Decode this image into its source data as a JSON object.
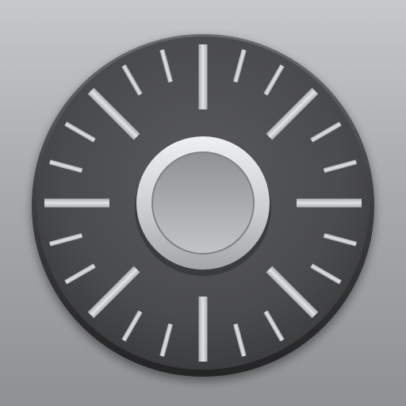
{
  "icon": {
    "name": "combination-dial-icon",
    "colors": {
      "background_top": "#c6c8ca",
      "background_bottom": "#8e9193",
      "dial_face": "#4d4e50",
      "dial_rim": "#2e2f31",
      "tick_marks": "#c4c6c9",
      "knob_outer": "#dcdee0",
      "knob_inner": "#a9abae"
    },
    "tick_count": 24,
    "major_tick_every": 3
  }
}
